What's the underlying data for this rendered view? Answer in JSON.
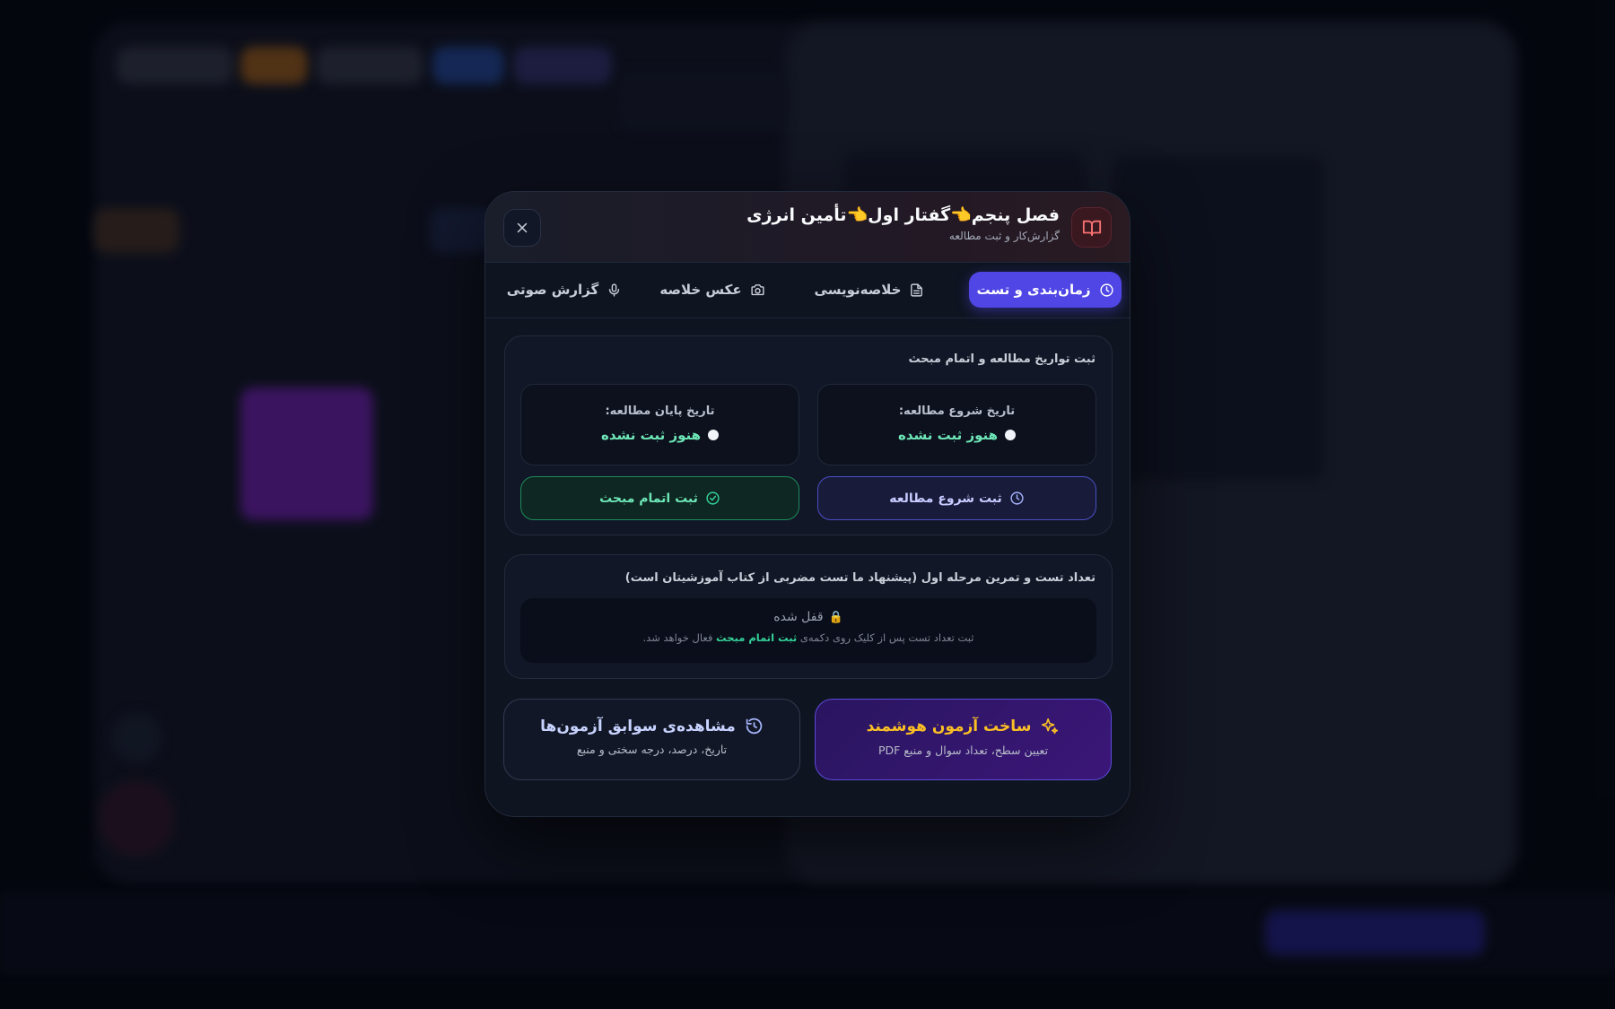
{
  "header": {
    "title": "فصل پنجم👈گفتار اول👈تأمین انرژی",
    "subtitle": "گزارش‌کار و ثبت مطالعه"
  },
  "tabs": [
    {
      "label": "زمان‌بندی و تست",
      "icon": "clock-icon",
      "active": true
    },
    {
      "label": "خلاصه‌نویسی",
      "icon": "file-text-icon",
      "active": false
    },
    {
      "label": "عکس خلاصه",
      "icon": "camera-icon",
      "active": false
    },
    {
      "label": "گزارش صوتی",
      "icon": "mic-icon",
      "active": false
    }
  ],
  "dates_card": {
    "title": "ثبت تواریخ مطالعه و اتمام مبحث",
    "start_label": "تاریخ شروع مطالعه:",
    "start_value": "هنوز ثبت نشده",
    "end_label": "تاریخ پایان مطالعه:",
    "end_value": "هنوز ثبت نشده",
    "start_button": "ثبت شروع مطالعه",
    "finish_button": "ثبت اتمام مبحث"
  },
  "tests_card": {
    "title": "تعداد تست و تمرین مرحله اول (پیشنهاد ما تست مضربی از کتاب آموزشیتان است)",
    "locked_title": "قفل شده",
    "locked_desc_before": "ثبت تعداد تست پس از کلیک روی دکمه‌ی",
    "locked_desc_highlight": "ثبت اتمام مبحث",
    "locked_desc_after": "فعال خواهد شد."
  },
  "actions": {
    "smart_title": "ساخت آزمون هوشمند",
    "smart_sub": "تعیین سطح، تعداد سوال و منبع PDF",
    "history_title": "مشاهده‌ی سوابق آزمون‌ها",
    "history_sub": "تاریخ، درصد، درجه سختی و منبع"
  },
  "colors": {
    "accent": "#4f46e5",
    "success": "#6ee7b7",
    "smart_title": "#fbbf24",
    "book_icon": "#f87171"
  }
}
